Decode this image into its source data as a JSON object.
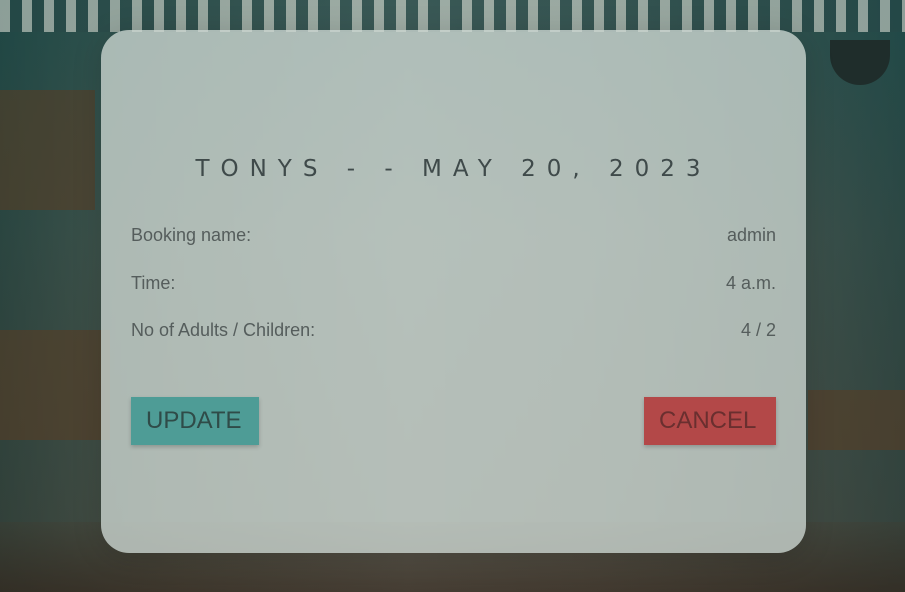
{
  "booking": {
    "title": "TONYS - - MAY 20, 2023",
    "fields": [
      {
        "label": "Booking name:",
        "value": "admin"
      },
      {
        "label": "Time:",
        "value": "4 a.m."
      },
      {
        "label": "No of Adults / Children:",
        "value": "4 / 2"
      }
    ]
  },
  "actions": {
    "update_label": "UPDATE",
    "cancel_label": "CANCEL"
  },
  "colors": {
    "update_button": "#4e9c96",
    "cancel_button": "#b34848"
  }
}
